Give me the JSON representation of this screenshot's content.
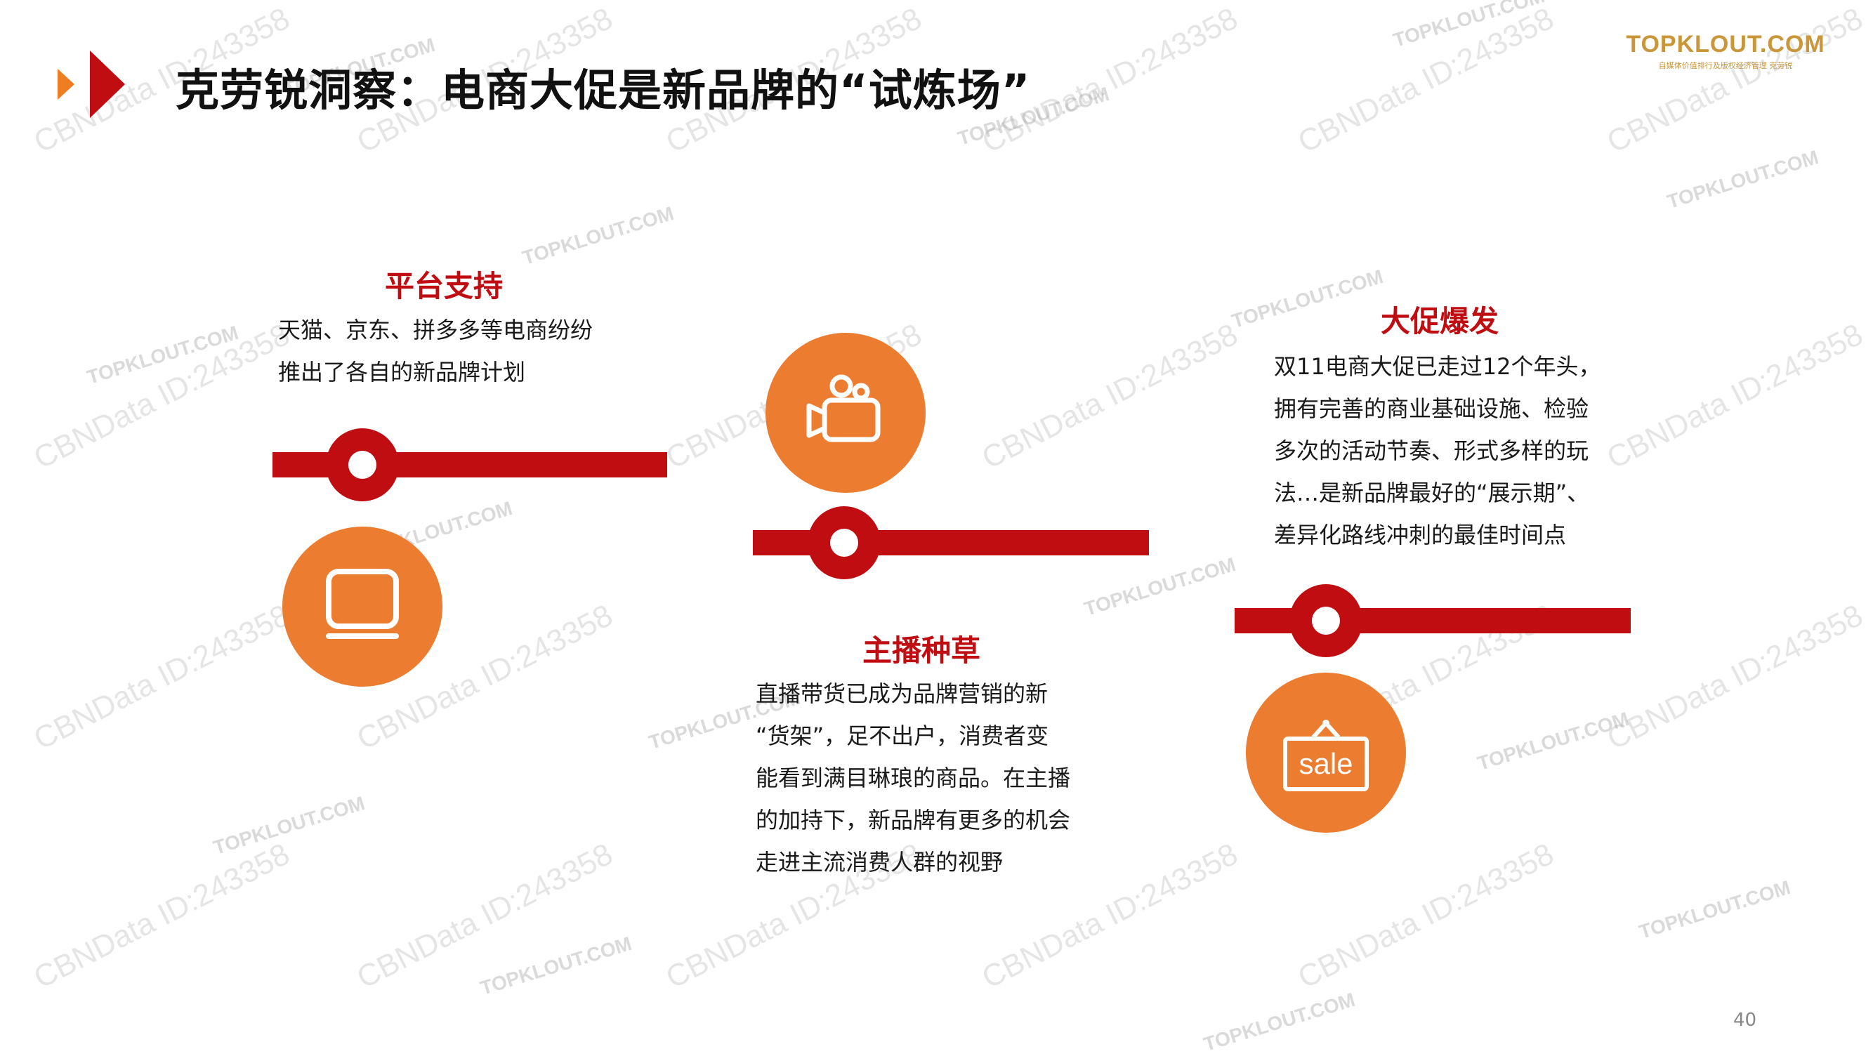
{
  "slide": {
    "title": "克劳锐洞察：电商大促是新品牌的“试炼场”",
    "page_number": "40"
  },
  "logo": {
    "brand": "TOPKLOUT.COM",
    "subtitle": "自媒体价值排行及版权经济管理 克劳锐"
  },
  "sections": [
    {
      "title": "平台支持",
      "lines": [
        "天猫、京东、拼多多等电商纷纷",
        "推出了各自的新品牌计划"
      ],
      "icon": "monitor-icon"
    },
    {
      "title": "主播种草",
      "lines": [
        "直播带货已成为品牌营销的新",
        "“货架”，足不出户，消费者变",
        "能看到满目琳琅的商品。在主播",
        "的加持下，新品牌有更多的机会",
        "走进主流消费人群的视野"
      ],
      "icon": "video-camera-icon"
    },
    {
      "title": "大促爆发",
      "lines": [
        "双11电商大促已走过12个年头，",
        "拥有完善的商业基础设施、检验",
        "多次的活动节奏、形式多样的玩",
        "法…是新品牌最好的“展示期”、",
        "差异化路线冲刺的最佳时间点"
      ],
      "icon": "sale-sign-icon",
      "icon_label": "sale"
    }
  ],
  "watermarks": {
    "cbn": "CBNData ID:243358",
    "topklout": "TOPKLOUT.COM"
  },
  "colors": {
    "accent_red": "#c00d12",
    "accent_orange": "#ec7c30",
    "logo_gold": "#c9963a"
  }
}
